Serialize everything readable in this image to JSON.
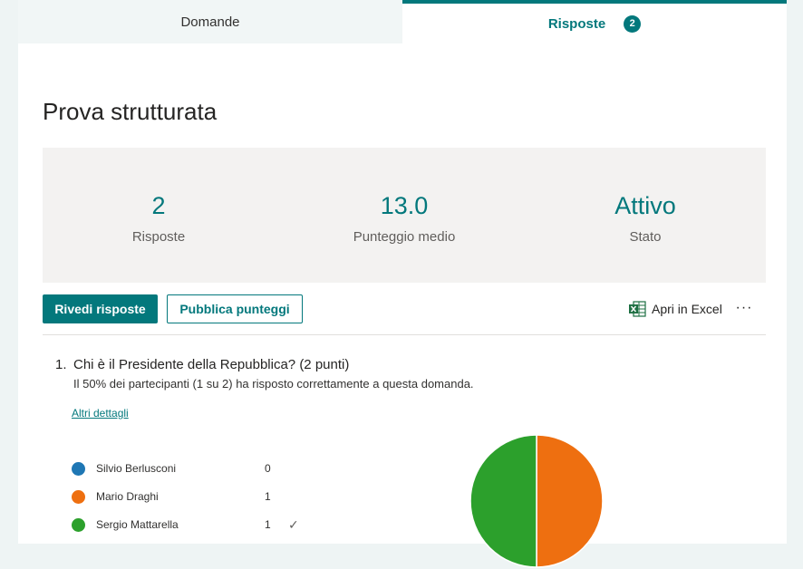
{
  "tabs": [
    {
      "label": "Domande"
    },
    {
      "label": "Risposte",
      "badge": "2"
    }
  ],
  "form": {
    "title": "Prova strutturata"
  },
  "summary": {
    "responses": {
      "value": "2",
      "label": "Risposte"
    },
    "avg_score": {
      "value": "13.0",
      "label": "Punteggio medio"
    },
    "status": {
      "value": "Attivo",
      "label": "Stato"
    }
  },
  "toolbar": {
    "review_label": "Rivedi risposte",
    "publish_label": "Pubblica punteggi",
    "excel_label": "Apri in Excel",
    "more_label": "···"
  },
  "question": {
    "number": "1.",
    "title": "Chi è il Presidente della Repubblica? (2 punti)",
    "subtitle": "Il 50% dei partecipanti (1 su 2) ha risposto correttamente a questa domanda.",
    "details_link": "Altri dettagli",
    "options": [
      {
        "label": "Silvio Berlusconi",
        "count": "0",
        "color": "#1f77b4",
        "correct": false
      },
      {
        "label": "Mario Draghi",
        "count": "1",
        "color": "#ee6f10",
        "correct": false
      },
      {
        "label": "Sergio Mattarella",
        "count": "1",
        "color": "#2ca02c",
        "correct": true
      }
    ],
    "check_glyph": "✓"
  },
  "chart_data": {
    "type": "pie",
    "categories": [
      "Silvio Berlusconi",
      "Mario Draghi",
      "Sergio Mattarella"
    ],
    "values": [
      0,
      1,
      1
    ],
    "colors": [
      "#1f77b4",
      "#ee6f10",
      "#2ca02c"
    ]
  },
  "colors": {
    "accent": "#03787c"
  }
}
